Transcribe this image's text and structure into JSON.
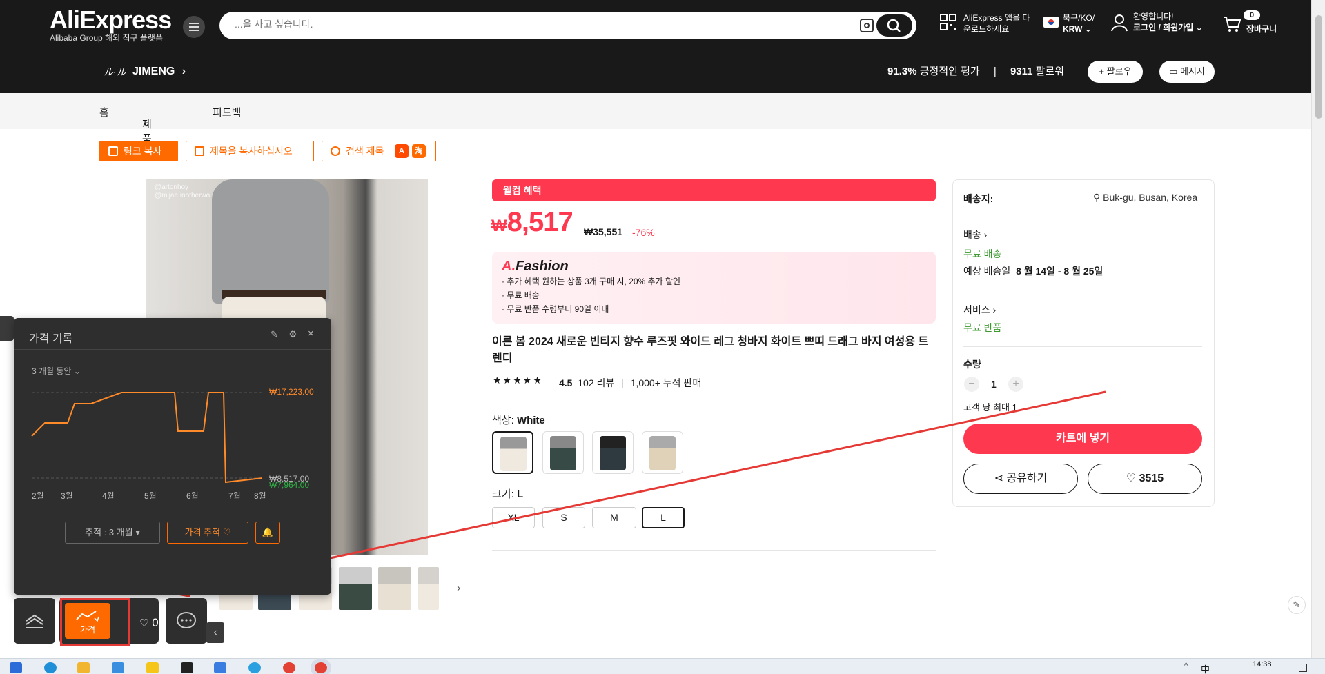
{
  "header": {
    "logo_name": "AliExpress",
    "logo_sub": "Alibaba Group 해외 직구 플랫폼",
    "search_placeholder": "...을 사고 싶습니다.",
    "app_download": [
      "AliExpress 앱을 다",
      "운로드하세요"
    ],
    "region": [
      "북구/KO/",
      "KRW"
    ],
    "account": [
      "환영합니다!",
      "로그인 / 회원가입"
    ],
    "cart_label": "장바구니",
    "cart_count": "0"
  },
  "store": {
    "logo": "ル·ル",
    "name": "JIMENG",
    "rating_value": "91.3%",
    "rating_text": "긍정적인 평가",
    "followers_value": "9311",
    "followers_text": "팔로워",
    "follow_label": "+ 팔로우",
    "message_label": "메시지"
  },
  "nav": [
    "홈",
    "제품",
    "피드백"
  ],
  "utility": {
    "copy_link": "링크 복사",
    "copy_title": "제목을 복사하십시오",
    "search_title": "검색 제목"
  },
  "gallery": {
    "watermark": [
      "@artonhoy",
      "@mijae.inotherwo"
    ]
  },
  "product": {
    "welcome": "웰컴 혜택",
    "currency": "₩",
    "price": "8,517",
    "old_price": "₩35,551",
    "discount": "-76%",
    "promo_brand_a": "A.",
    "promo_brand_b": "Fashion",
    "promo_lines": [
      "· 추가 혜택 원하는 상품 3개 구매 시, 20% 추가 할인",
      "· 무료 배송",
      "· 무료 반품 수령부터 90일 이내"
    ],
    "title": "이른 봄 2024 새로운 빈티지 향수 루즈핏 와이드 레그 청바지 화이트 쁘띠 드래그 바지 여성용 트렌디",
    "stars": "★★★★★",
    "rating": "4.5",
    "reviews": "102 리뷰",
    "sold": "1,000+ 누적 판매",
    "color_label": "색상:",
    "color_value": "White",
    "size_label": "크기:",
    "size_value": "L",
    "sizes": [
      "XL",
      "S",
      "M",
      "L"
    ]
  },
  "shipping": {
    "ship_to_label": "배송지:",
    "ship_to_value": "Buk-gu, Busan, Korea",
    "delivery_label": "배송",
    "delivery_free": "무료 배송",
    "eta_prefix": "예상 배송일",
    "eta_range": "8 월 14일 - 8 월 25일",
    "service_label": "서비스",
    "service_value": "무료 반품",
    "qty_label": "수량",
    "qty_value": "1",
    "qty_limit": "고객 당 최대 1",
    "cart_button": "카트에 넣기",
    "share_button": "공유하기",
    "wish_count": "3515"
  },
  "price_history": {
    "title": "가격 기록",
    "range": "3 개월 동안",
    "high": "₩17,223.00",
    "current": "₩8,517.00",
    "low": "₩7,964.00",
    "months": [
      "2월",
      "3월",
      "4월",
      "5월",
      "6월",
      "7월",
      "8월"
    ],
    "track_select": "추적 : 3 개월",
    "track_button": "가격 추적"
  },
  "dock": {
    "price_button": "가격",
    "wish_count": "0"
  },
  "taskbar": {
    "ime": "中",
    "time": "14:38"
  },
  "colors": {
    "accent_red": "#fd384f",
    "orange": "#ff6a00",
    "header_bg": "#191919"
  }
}
